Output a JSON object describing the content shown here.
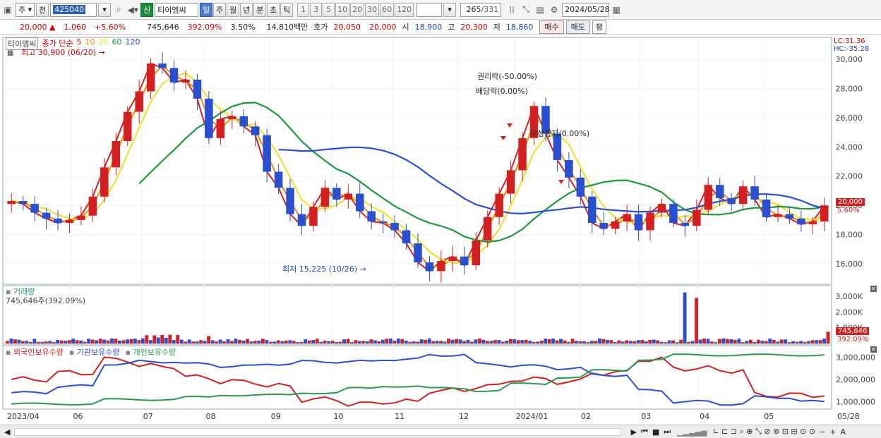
{
  "toolbar": {
    "period_select": "주",
    "prev_label": "전",
    "code": "425040",
    "new_badge": "신",
    "stock_name": "티이엠씨",
    "period_tabs": [
      "일",
      "주",
      "월",
      "년",
      "분",
      "초",
      "틱"
    ],
    "period_active_index": 0,
    "interval_buttons": [
      "1",
      "3",
      "5",
      "10",
      "20",
      "30",
      "60",
      "120"
    ],
    "count": "265",
    "total": "/331",
    "date": "2024/05/28"
  },
  "info": {
    "price": "20,000",
    "change": "1,060",
    "change_pct": "+5.60%",
    "volume": "745,646",
    "volume_pct": "392.09%",
    "turnover_pct": "3.50%",
    "amount": "14,810백만",
    "ask_label": "호가",
    "ask1": "20,050",
    "ask2": "20,000",
    "open_label": "시",
    "open": "18,900",
    "high_label": "고",
    "high": "20,300",
    "low_label": "저",
    "low": "18,860",
    "buy_label": "매수",
    "sell_label": "매도",
    "avg_label": "평"
  },
  "price_panel": {
    "name_tag": "티이엠씨",
    "ma_title": "종가 단순",
    "ma_periods": [
      "5",
      "10",
      "20",
      "60",
      "120"
    ],
    "ma_colors": [
      "#d42020",
      "#f08c00",
      "#f0e020",
      "#1a9a3a",
      "#2a4fd0"
    ],
    "high_note": "최고 30,900 (06/20)",
    "low_note": "최저 15,225 (10/26)",
    "event_rights": "권리락(-50.00%)",
    "event_dividend": "배당락(0.00%)",
    "event_bonus": "무상증자(0.00%)",
    "lc": "LC:31.36",
    "hc": "HC:-35.28",
    "cur_price_tag": "20,000",
    "cur_pct_tag": "5.60%",
    "yticks": [
      "30,000",
      "28,000",
      "26,000",
      "24,000",
      "22,000",
      "20,000",
      "18,000",
      "16,000"
    ]
  },
  "volume_panel": {
    "title": "거래량",
    "value": "745,646주(392.09%)",
    "yticks": [
      "3,000K",
      "2,000K",
      "1,000K"
    ],
    "tag_vol": "745,646",
    "tag_pct": "392.09%"
  },
  "holdings_panel": {
    "legend": [
      "외국인보유수량",
      "기관보유수량",
      "개인보유수량"
    ],
    "legend_colors": [
      "#d42020",
      "#2a4fd0",
      "#2a9a50"
    ],
    "yticks": [
      "3,000,000",
      "2,000,000",
      "1,000,000"
    ]
  },
  "xaxis": [
    "2023/04",
    "06",
    "07",
    "08",
    "09",
    "10",
    "11",
    "12",
    "2024/01",
    "02",
    "03",
    "04",
    "05",
    "05/28"
  ],
  "colors": {
    "up": "#d42020",
    "down": "#2a4fd0",
    "accent": "#2d5fb5"
  },
  "chart_data": {
    "type": "candlestick",
    "title": "티이엠씨",
    "ylim": [
      14800,
      31200
    ],
    "weekly_close": [
      20300,
      20100,
      19500,
      19100,
      18800,
      19000,
      19300,
      20600,
      22600,
      24400,
      26400,
      27800,
      29700,
      29400,
      28400,
      28600,
      27300,
      24600,
      25900,
      26100,
      25400,
      24800,
      22300,
      21200,
      19400,
      18600,
      19900,
      21200,
      20400,
      20800,
      19600,
      18900,
      18800,
      18300,
      17400,
      16100,
      15500,
      16200,
      16500,
      15900,
      17600,
      19200,
      20800,
      22400,
      24600,
      26800,
      24900,
      23100,
      21900,
      20600,
      18800,
      18400,
      18900,
      19400,
      18300,
      19500,
      20100,
      18800,
      18600,
      19700,
      21400,
      20500,
      20100,
      21300,
      20400,
      19200,
      19400,
      19100,
      18700,
      18900,
      20000
    ]
  }
}
